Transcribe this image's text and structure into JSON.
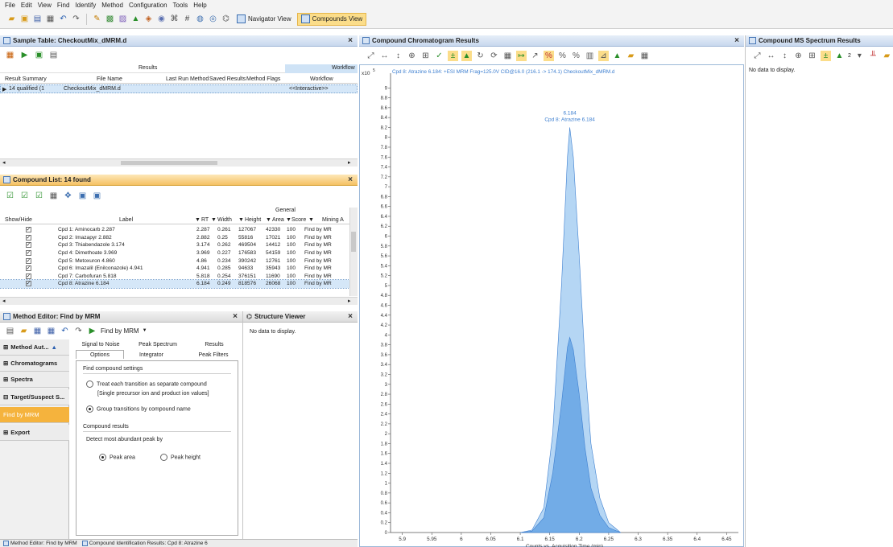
{
  "menu": [
    "File",
    "Edit",
    "View",
    "Find",
    "Identify",
    "Method",
    "Configuration",
    "Tools",
    "Help"
  ],
  "toolbar": {
    "navigator_label": "Navigator View",
    "compounds_label": "Compounds View"
  },
  "sample_table": {
    "title": "Sample Table: CheckoutMix_dMRM.d",
    "group_results": "Results",
    "group_workflow": "Workflow",
    "columns": [
      "Result Summary",
      "File Name",
      "Last Run Method",
      "Saved Results",
      "Method Flags",
      "Workflow"
    ],
    "row": {
      "summary": "14 qualified (1",
      "file": "CheckoutMix_dMRM.d",
      "workflow": "<<Interactive>>"
    }
  },
  "compound_list": {
    "title": "Compound List: 14 found",
    "group": "General",
    "columns": [
      "Show/Hide",
      "Label",
      "RT",
      "Width",
      "Height",
      "Area",
      "Score",
      "Mining A"
    ],
    "rows": [
      {
        "label": "Cpd 1: Aminocarb 2.287",
        "rt": "2.287",
        "width": "0.261",
        "height": "127067",
        "area": "42330",
        "score": "100",
        "mining": "Find by MR"
      },
      {
        "label": "Cpd 2: Imazapyr 2.882",
        "rt": "2.882",
        "width": "0.25",
        "height": "55816",
        "area": "17021",
        "score": "100",
        "mining": "Find by MR"
      },
      {
        "label": "Cpd 3: Thiabendazole 3.174",
        "rt": "3.174",
        "width": "0.262",
        "height": "469504",
        "area": "14412",
        "score": "100",
        "mining": "Find by MR"
      },
      {
        "label": "Cpd 4: Dimethoate 3.969",
        "rt": "3.969",
        "width": "0.227",
        "height": "176583",
        "area": "54159",
        "score": "100",
        "mining": "Find by MR"
      },
      {
        "label": "Cpd 5: Metoxuron 4.860",
        "rt": "4.86",
        "width": "0.234",
        "height": "390242",
        "area": "12761",
        "score": "100",
        "mining": "Find by MR"
      },
      {
        "label": "Cpd 6: Imazalil (Enilconazole) 4.941",
        "rt": "4.941",
        "width": "0.285",
        "height": "94633",
        "area": "35943",
        "score": "100",
        "mining": "Find by MR"
      },
      {
        "label": "Cpd 7: Carbofuran 5.818",
        "rt": "5.818",
        "width": "0.254",
        "height": "376151",
        "area": "11690",
        "score": "100",
        "mining": "Find by MR"
      },
      {
        "label": "Cpd 8: Atrazine 6.184",
        "rt": "6.184",
        "width": "0.249",
        "height": "818576",
        "area": "26068",
        "score": "100",
        "mining": "Find by MR"
      }
    ]
  },
  "method_editor": {
    "title": "Method Editor: Find by MRM",
    "dropdown": "Find by MRM",
    "nav": [
      "Method Aut...",
      "Chromatograms",
      "Spectra",
      "Target/Suspect S...",
      "Find by MRM",
      "Export"
    ],
    "tabs_row1": [
      "Signal to Noise",
      "Peak Spectrum",
      "Results"
    ],
    "tabs_row2": [
      "Options",
      "Integrator",
      "Peak Filters"
    ],
    "section1": "Find compound settings",
    "opt1": "Treat each transition as separate compound",
    "opt1_sub": "[Single precursor ion and product ion values]",
    "opt2": "Group transitions by compound name",
    "section2": "Compound results",
    "detect_label": "Detect most abundant peak by",
    "opt_area": "Peak area",
    "opt_height": "Peak height"
  },
  "structure_viewer": {
    "title": "Structure Viewer",
    "empty": "No data to display."
  },
  "bottom_tabs": [
    "Method Editor: Find by MRM",
    "Compound Identification Results: Cpd 8: Atrazine 6"
  ],
  "chromatogram": {
    "title": "Compound Chromatogram Results",
    "header": "Cpd 8: Atrazine 6.184: +ESI MRM Frag=125.0V CID@16.0 (216.1 -> 174.1) CheckoutMix_dMRM.d",
    "peak_label_rt": "6.184",
    "peak_label_name": "Cpd 8: Atrazine 6.184",
    "y_exponent": "x10",
    "y_exp_power": "5",
    "x_axis_label": "Counts vs. Acquisition Time (min)"
  },
  "ms_spectrum": {
    "title": "Compound MS Spectrum Results",
    "empty": "No data to display.",
    "toolbar_num": "2"
  },
  "chart_data": {
    "type": "area",
    "title": "Cpd 8: Atrazine 6.184: +ESI MRM Frag=125.0V CID@16.0 (216.1 -> 174.1) CheckoutMix_dMRM.d",
    "xlabel": "Counts vs. Acquisition Time (min)",
    "ylabel": "x10^5",
    "xlim": [
      5.88,
      6.47
    ],
    "ylim": [
      0,
      9.2
    ],
    "xticks": [
      "5.9",
      "5.95",
      "6",
      "6.05",
      "6.1",
      "6.15",
      "6.2",
      "6.25",
      "6.3",
      "6.35",
      "6.4",
      "6.45"
    ],
    "yticks": [
      "0",
      "0.2",
      "0.4",
      "0.6",
      "0.8",
      "1",
      "1.2",
      "1.4",
      "1.6",
      "1.8",
      "2",
      "2.2",
      "2.4",
      "2.6",
      "2.8",
      "3",
      "3.2",
      "3.4",
      "3.6",
      "3.8",
      "4",
      "4.2",
      "4.4",
      "4.6",
      "4.8",
      "5",
      "5.2",
      "5.4",
      "5.6",
      "5.8",
      "6",
      "6.2",
      "6.4",
      "6.6",
      "6.8",
      "7",
      "7.2",
      "7.4",
      "7.6",
      "7.8",
      "8",
      "8.2",
      "8.4",
      "8.6",
      "8.8",
      "9"
    ],
    "series": [
      {
        "values": [
          [
            6.1,
            0
          ],
          [
            6.12,
            0.05
          ],
          [
            6.14,
            0.5
          ],
          [
            6.155,
            2.0
          ],
          [
            6.17,
            5.0
          ],
          [
            6.18,
            7.6
          ],
          [
            6.184,
            8.2
          ],
          [
            6.19,
            7.6
          ],
          [
            6.2,
            5.6
          ],
          [
            6.21,
            3.4
          ],
          [
            6.22,
            1.8
          ],
          [
            6.235,
            0.7
          ],
          [
            6.25,
            0.2
          ],
          [
            6.27,
            0
          ]
        ]
      },
      {
        "values": [
          [
            6.1,
            0
          ],
          [
            6.12,
            0.03
          ],
          [
            6.14,
            0.3
          ],
          [
            6.155,
            1.2
          ],
          [
            6.17,
            2.6
          ],
          [
            6.18,
            3.75
          ],
          [
            6.184,
            3.95
          ],
          [
            6.19,
            3.7
          ],
          [
            6.2,
            2.8
          ],
          [
            6.21,
            1.7
          ],
          [
            6.22,
            0.9
          ],
          [
            6.235,
            0.35
          ],
          [
            6.25,
            0.1
          ],
          [
            6.27,
            0
          ]
        ]
      }
    ],
    "colors": [
      "#a8cff2",
      "#6aa7e6"
    ]
  }
}
